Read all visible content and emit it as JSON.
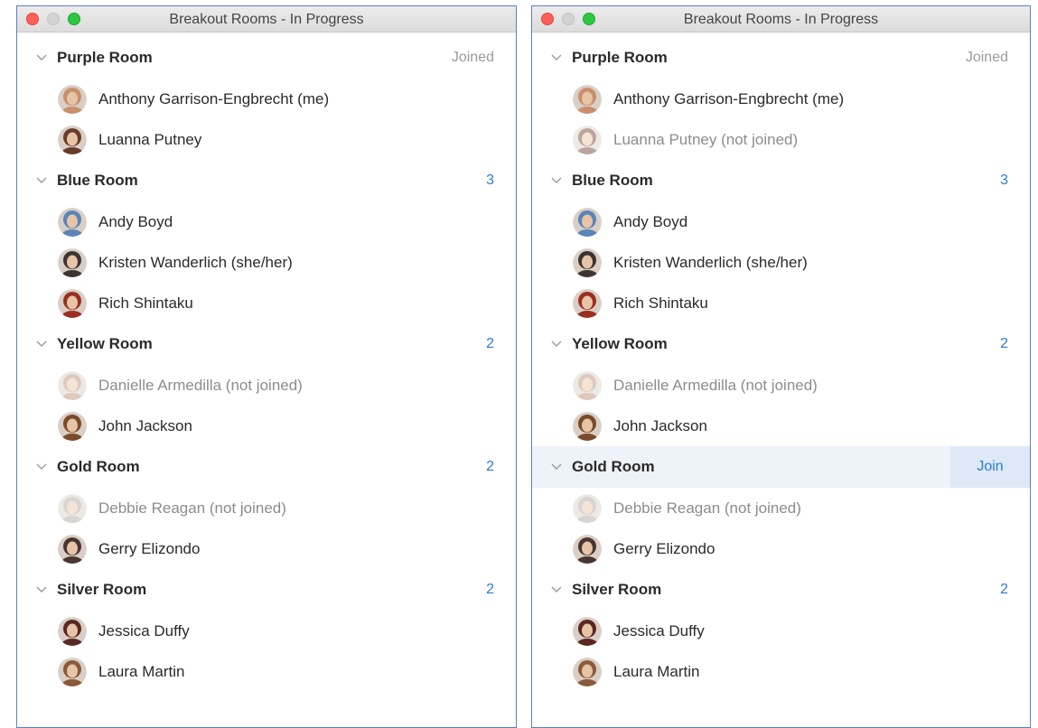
{
  "windows": [
    {
      "title": "Breakout Rooms - In Progress",
      "rooms": [
        {
          "name": "Purple Room",
          "status": "Joined",
          "status_kind": "joined",
          "highlight": false,
          "participants": [
            {
              "name": "Anthony Garrison-Engbrecht (me)",
              "dim": false,
              "color": "#c98f6b"
            },
            {
              "name": "Luanna Putney",
              "dim": false,
              "color": "#6a3b28"
            }
          ]
        },
        {
          "name": "Blue Room",
          "status": "3",
          "status_kind": "count",
          "highlight": false,
          "participants": [
            {
              "name": "Andy Boyd",
              "dim": false,
              "color": "#5b84b8"
            },
            {
              "name": "Kristen Wanderlich (she/her)",
              "dim": false,
              "color": "#3d3330"
            },
            {
              "name": "Rich Shintaku",
              "dim": false,
              "color": "#9a2f22"
            }
          ]
        },
        {
          "name": "Yellow Room",
          "status": "2",
          "status_kind": "count",
          "highlight": false,
          "participants": [
            {
              "name": "Danielle Armedilla (not joined)",
              "dim": true,
              "color": "#b58a6e"
            },
            {
              "name": "John Jackson",
              "dim": false,
              "color": "#7a4a2a"
            }
          ]
        },
        {
          "name": "Gold Room",
          "status": "2",
          "status_kind": "count",
          "highlight": false,
          "participants": [
            {
              "name": "Debbie Reagan (not joined)",
              "dim": true,
              "color": "#a9a29a"
            },
            {
              "name": "Gerry Elizondo",
              "dim": false,
              "color": "#4a3630"
            }
          ]
        },
        {
          "name": "Silver Room",
          "status": "2",
          "status_kind": "count",
          "highlight": false,
          "participants": [
            {
              "name": "Jessica Duffy",
              "dim": false,
              "color": "#5a2820"
            },
            {
              "name": "Laura Martin",
              "dim": false,
              "color": "#8a5a3a"
            }
          ]
        }
      ]
    },
    {
      "title": "Breakout Rooms - In Progress",
      "rooms": [
        {
          "name": "Purple Room",
          "status": "Joined",
          "status_kind": "joined",
          "highlight": false,
          "participants": [
            {
              "name": "Anthony Garrison-Engbrecht (me)",
              "dim": false,
              "color": "#c98f6b"
            },
            {
              "name": "Luanna Putney (not joined)",
              "dim": true,
              "color": "#6a3b28"
            }
          ]
        },
        {
          "name": "Blue Room",
          "status": "3",
          "status_kind": "count",
          "highlight": false,
          "participants": [
            {
              "name": "Andy Boyd",
              "dim": false,
              "color": "#5b84b8"
            },
            {
              "name": "Kristen Wanderlich (she/her)",
              "dim": false,
              "color": "#3d3330"
            },
            {
              "name": "Rich Shintaku",
              "dim": false,
              "color": "#9a2f22"
            }
          ]
        },
        {
          "name": "Yellow Room",
          "status": "2",
          "status_kind": "count",
          "highlight": false,
          "participants": [
            {
              "name": "Danielle Armedilla (not joined)",
              "dim": true,
              "color": "#b58a6e"
            },
            {
              "name": "John Jackson",
              "dim": false,
              "color": "#7a4a2a"
            }
          ]
        },
        {
          "name": "Gold Room",
          "status": "Join",
          "status_kind": "join",
          "highlight": true,
          "participants": [
            {
              "name": "Debbie Reagan (not joined)",
              "dim": true,
              "color": "#a9a29a"
            },
            {
              "name": "Gerry Elizondo",
              "dim": false,
              "color": "#4a3630"
            }
          ]
        },
        {
          "name": "Silver Room",
          "status": "2",
          "status_kind": "count",
          "highlight": false,
          "participants": [
            {
              "name": "Jessica Duffy",
              "dim": false,
              "color": "#5a2820"
            },
            {
              "name": "Laura Martin",
              "dim": false,
              "color": "#8a5a3a"
            }
          ]
        }
      ]
    }
  ],
  "colors": {
    "accent": "#2b7bd4",
    "joined_text": "#9a9a9a",
    "dim_text": "#8c8c8c",
    "highlight_row": "#eef3f9",
    "join_button_bg": "#dde9f6",
    "window_border": "#5b7fc4"
  }
}
